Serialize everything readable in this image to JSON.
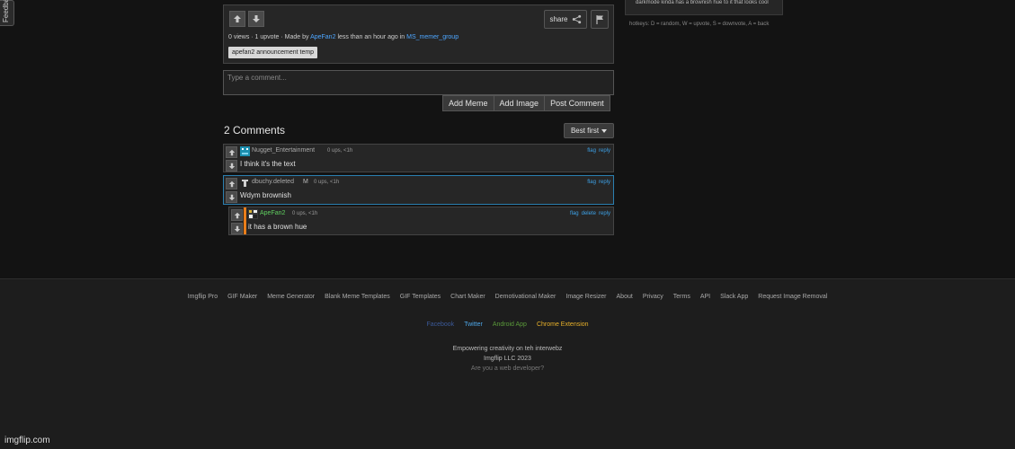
{
  "feedback_tab": "Feedback",
  "post": {
    "share_label": "share",
    "meta_prefix": "0 views · 1 upvote · Made by",
    "author": "ApeFan2",
    "meta_middle": "less than an hour ago in",
    "stream": "MS_memer_group",
    "tag": "apefan2 announcement temp"
  },
  "sidebar": {
    "caption": "darkmode kinda has a brownish hue to it that looks cool",
    "hotkeys": "hotkeys: D = random, W = upvote, S = downvote, A = back"
  },
  "comment_box": {
    "placeholder": "Type a comment...",
    "add_meme": "Add Meme",
    "add_image": "Add Image",
    "post_comment": "Post Comment"
  },
  "comments_section": {
    "heading": "2 Comments",
    "sort_label": "Best first"
  },
  "comments": [
    {
      "username": "Nugget_Entertainment",
      "meta": "0 ups, <1h",
      "text": "I think it's the text",
      "links": [
        "flag",
        "reply"
      ]
    },
    {
      "username": "dbuchy.deleted",
      "badge": "M",
      "meta": "0 ups, <1h",
      "text": "Wdym brownish",
      "links": [
        "flag",
        "reply"
      ]
    },
    {
      "username": "ApeFan2",
      "meta": "0 ups, <1h",
      "text": "it has a brown hue",
      "links": [
        "flag",
        "delete",
        "reply"
      ]
    }
  ],
  "footer": {
    "links": [
      "Imgflip Pro",
      "GIF Maker",
      "Meme Generator",
      "Blank Meme Templates",
      "GIF Templates",
      "Chart Maker",
      "Demotivational Maker",
      "Image Resizer",
      "About",
      "Privacy",
      "Terms",
      "API",
      "Slack App",
      "Request Image Removal"
    ],
    "social": [
      {
        "label": "Facebook",
        "color": "#3b5998"
      },
      {
        "label": "Twitter",
        "color": "#4da6e8"
      },
      {
        "label": "Android App",
        "color": "#5a9a3a"
      },
      {
        "label": "Chrome Extension",
        "color": "#e8b12a"
      }
    ],
    "tagline": "Empowering creativity on teh interwebz",
    "copyright": "Imgflip LLC 2023",
    "developer": "Are you a web developer?"
  },
  "watermark": "imgflip.com",
  "colors": {
    "background": "#131313",
    "panel": "#262626",
    "link": "#4da6ff",
    "op_accent": "#e87d1a",
    "highlight_border": "#2a7fb0"
  }
}
